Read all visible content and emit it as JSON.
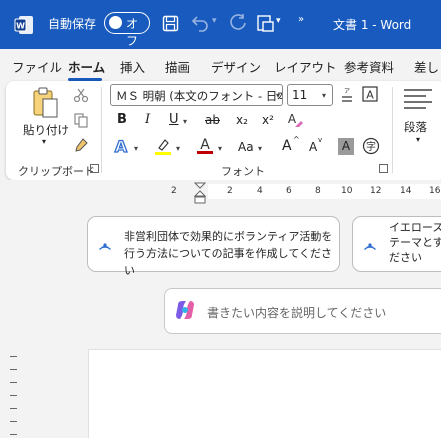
{
  "titlebar": {
    "autosave_label": "自動保存",
    "autosave_state": "オフ",
    "more_symbol": "»",
    "doc_title": "文書 1 - Word"
  },
  "tabs": [
    "ファイル",
    "ホーム",
    "挿入",
    "描画",
    "デザイン",
    "レイアウト",
    "参考資料",
    "差し"
  ],
  "ribbon": {
    "paste_label": "貼り付け",
    "clipboard_label": "クリップボード",
    "font_name": "ＭＳ 明朝 (本文のフォント - 日本語)",
    "font_size": "11",
    "font_group_label": "フォント",
    "paragraph_label": "段落",
    "buttons": {
      "bold": "B",
      "italic": "I",
      "underline": "U",
      "strike": "ab",
      "subscript": "x₂",
      "superscript": "x²",
      "case": "Aa",
      "grow": "A",
      "shrink": "A",
      "shade": "A",
      "char_border": "A",
      "phonetic": "亜"
    }
  },
  "ruler": {
    "numbers": [
      "2",
      "2",
      "4",
      "6",
      "8",
      "10",
      "12",
      "14",
      "16"
    ]
  },
  "suggestions": [
    {
      "line1": "非営利団体で効果的にボランティア活動を",
      "line2": "行う方法についての記事を作成してください"
    },
    {
      "line1": "イエロースト",
      "line2": "テーマとする",
      "line3": "ださい"
    }
  ],
  "prompt": {
    "placeholder": "書きたい内容を説明してください"
  },
  "colors": {
    "titlebar": "#185abd",
    "accent": "#185abd",
    "highlight": "#ffff00",
    "font_color": "#c00000"
  }
}
